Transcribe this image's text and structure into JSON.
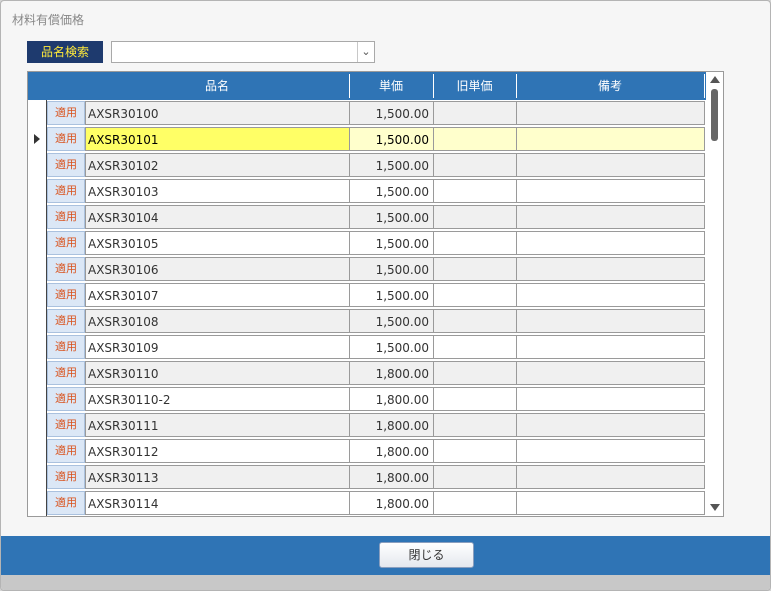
{
  "window": {
    "title": "材料有償価格"
  },
  "search": {
    "label": "品名検索",
    "value": "",
    "dropdown_icon": "chevron-down-icon"
  },
  "grid": {
    "columns": [
      "品名",
      "単価",
      "旧単価",
      "備考"
    ],
    "apply_label": "適用",
    "selected_row": 1,
    "rows": [
      {
        "name": "AXSR30100",
        "price": "1,500.00",
        "old_price": "",
        "note": ""
      },
      {
        "name": "AXSR30101",
        "price": "1,500.00",
        "old_price": "",
        "note": ""
      },
      {
        "name": "AXSR30102",
        "price": "1,500.00",
        "old_price": "",
        "note": ""
      },
      {
        "name": "AXSR30103",
        "price": "1,500.00",
        "old_price": "",
        "note": ""
      },
      {
        "name": "AXSR30104",
        "price": "1,500.00",
        "old_price": "",
        "note": ""
      },
      {
        "name": "AXSR30105",
        "price": "1,500.00",
        "old_price": "",
        "note": ""
      },
      {
        "name": "AXSR30106",
        "price": "1,500.00",
        "old_price": "",
        "note": ""
      },
      {
        "name": "AXSR30107",
        "price": "1,500.00",
        "old_price": "",
        "note": ""
      },
      {
        "name": "AXSR30108",
        "price": "1,500.00",
        "old_price": "",
        "note": ""
      },
      {
        "name": "AXSR30109",
        "price": "1,500.00",
        "old_price": "",
        "note": ""
      },
      {
        "name": "AXSR30110",
        "price": "1,800.00",
        "old_price": "",
        "note": ""
      },
      {
        "name": "AXSR30110-2",
        "price": "1,800.00",
        "old_price": "",
        "note": ""
      },
      {
        "name": "AXSR30111",
        "price": "1,800.00",
        "old_price": "",
        "note": ""
      },
      {
        "name": "AXSR30112",
        "price": "1,800.00",
        "old_price": "",
        "note": ""
      },
      {
        "name": "AXSR30113",
        "price": "1,800.00",
        "old_price": "",
        "note": ""
      },
      {
        "name": "AXSR30114",
        "price": "1,800.00",
        "old_price": "",
        "note": ""
      }
    ]
  },
  "footer": {
    "close_label": "閉じる"
  },
  "colors": {
    "header_blue": "#2f74b5",
    "label_navy": "#1e3a6e",
    "label_text": "#ffea3a",
    "selected_name": "#ffff66",
    "selected_row": "#ffffcc",
    "apply_text": "#d9531e"
  }
}
